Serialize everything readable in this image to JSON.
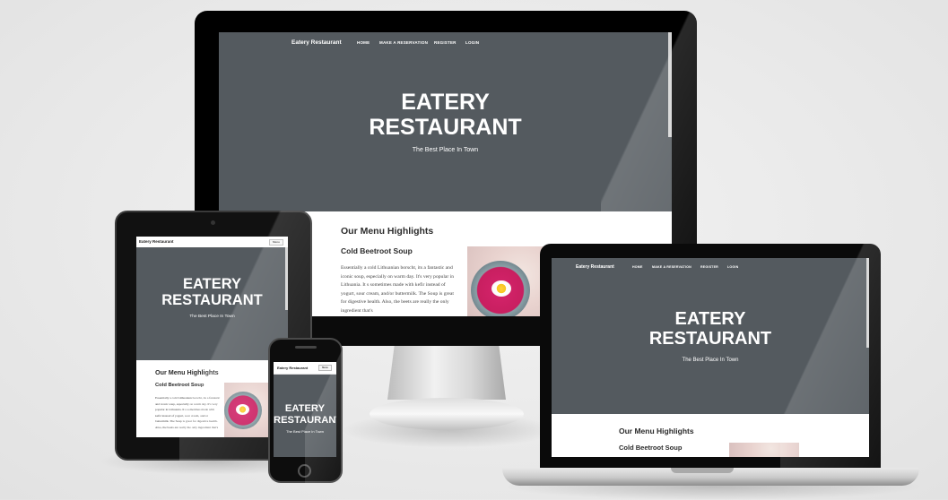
{
  "site": {
    "brand": "Eatery Restaurant",
    "nav": [
      "HOME",
      "MAKE A RESERVATION",
      "REGISTER",
      "LOGIN"
    ],
    "menu_button": "Menu",
    "hero_title_line1": "EATERY",
    "hero_title_line2": "RESTAURANT",
    "hero_tagline": "The Best Place In Town",
    "section_title": "Our Menu Highlights",
    "dish_title": "Cold Beetroot Soup",
    "dish_text": "Essentially a cold Lithuanian borscht, its a fantastic and iconic soup, especially on warm day. It's very popular in Lithuania. It s sometimes made with kefir instead of yogurt, sour cream, and/or buttermilk. The Soup is great for digestive health. Also, the beets are really the only ingredient that's"
  },
  "colors": {
    "hero_bg": "#545a5f",
    "accent_soup": "#d6246c"
  }
}
